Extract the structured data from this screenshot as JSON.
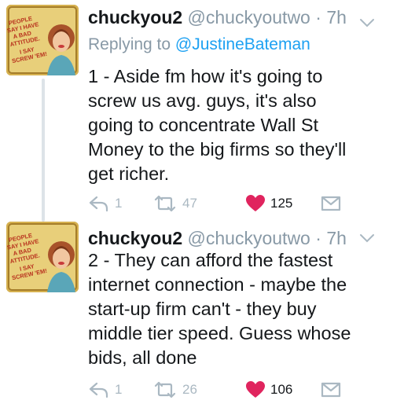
{
  "colors": {
    "accent": "#1da1f2",
    "muted": "#8899a6",
    "heart": "#e0245e",
    "icon": "#aab8c2"
  },
  "avatar_text": "PEOPLE SAY I HAVE A BAD ATTITUDE. I SAY SCREW 'EM!",
  "tweets": [
    {
      "name": "chuckyou2",
      "handle": "@chuckyoutwo",
      "sep": " · ",
      "time": "7h",
      "reply_prefix": "Replying to ",
      "reply_to": "@JustineBateman",
      "lines": [
        "1 - Aside fm how it's going to",
        "screw us avg. guys, it's also",
        "going to concentrate Wall St",
        "Money to the big firms so they'll",
        "get richer."
      ],
      "replies": "1",
      "retweets": "47",
      "likes": "125",
      "icons": [
        "reply-icon",
        "retweet-icon",
        "heart-icon",
        "dm-icon",
        "chevron-down-icon"
      ]
    },
    {
      "name": "chuckyou2",
      "handle": "@chuckyoutwo",
      "sep": " · ",
      "time": "7h",
      "lines": [
        "2 - They can afford the fastest",
        "internet connection - maybe the",
        "start-up firm can't - they buy",
        "middle tier speed. Guess whose",
        "bids, all done"
      ],
      "replies": "1",
      "retweets": "26",
      "likes": "106",
      "icons": [
        "reply-icon",
        "retweet-icon",
        "heart-icon",
        "dm-icon",
        "chevron-down-icon"
      ]
    }
  ]
}
